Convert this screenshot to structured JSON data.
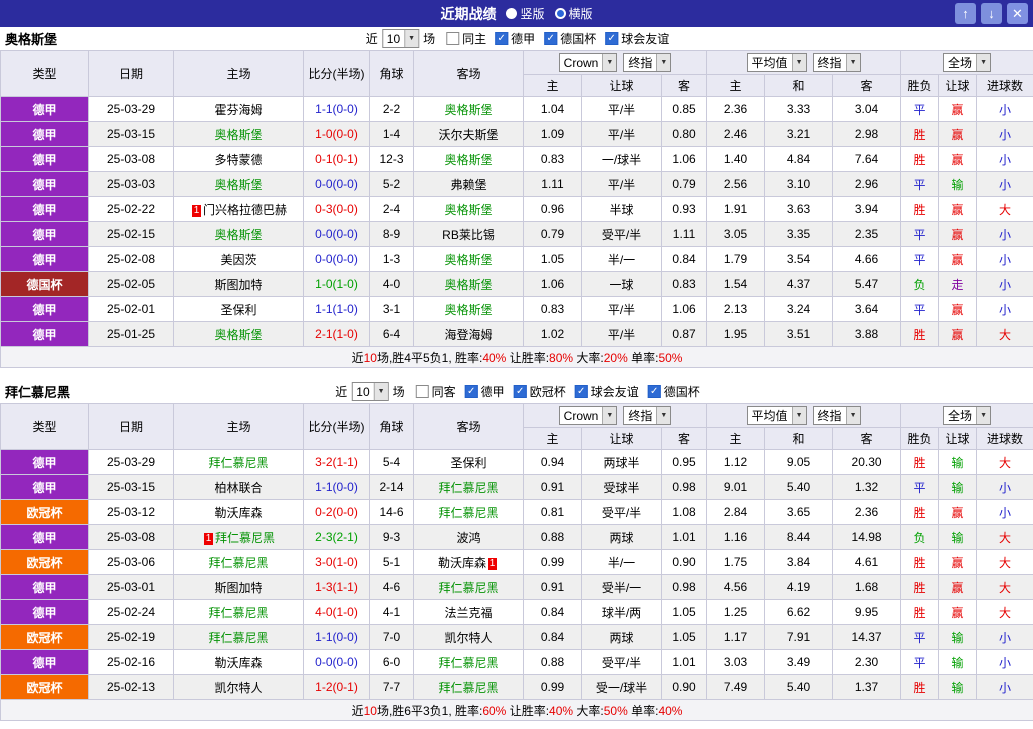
{
  "colors": {
    "titlebar_bg": "#2c2c9e",
    "header_bg": "#e9e9f3",
    "accent_blue": "#2e6bd4"
  },
  "titlebar": {
    "title": "近期战绩",
    "layout_options": [
      {
        "label": "竖版",
        "selected": false
      },
      {
        "label": "横版",
        "selected": true
      }
    ],
    "up_icon": "↑",
    "down_icon": "↓",
    "close_icon": "✕"
  },
  "table_columns": [
    "类型",
    "日期",
    "主场",
    "比分(半场)",
    "角球",
    "客场",
    "主",
    "让球",
    "客",
    "主",
    "和",
    "客",
    "胜负",
    "让球",
    "进球数"
  ],
  "league_colors": {
    "德甲": "#9327bd",
    "德国杯": "#a32626",
    "欧冠杯": "#f56a00"
  },
  "result_colors": {
    "胜": "#e60000",
    "平": "#2222cc",
    "负": "#00a000",
    "赢": "#e60000",
    "输": "#00a000",
    "走": "#8000a0",
    "大": "#e60000",
    "小": "#2222cc"
  },
  "sections": [
    {
      "team": "奥格斯堡",
      "filter": {
        "near_label": "近",
        "count": "10",
        "games_label": "场",
        "checkboxes": [
          {
            "label": "同主",
            "checked": false
          },
          {
            "label": "德甲",
            "checked": true
          },
          {
            "label": "德国杯",
            "checked": true
          },
          {
            "label": "球会友谊",
            "checked": true
          }
        ]
      },
      "header_selects": {
        "asia": [
          "Crown",
          "终指"
        ],
        "europe": [
          "平均值",
          "终指"
        ],
        "scope": [
          "全场"
        ]
      },
      "rows": [
        {
          "lg": "德甲",
          "dt": "25-03-29",
          "hm": "霍芬海姆",
          "hmF": false,
          "hmC": false,
          "sc": "1-1(0-0)",
          "cn": "2-2",
          "aw": "奥格斯堡",
          "awF": true,
          "awC": false,
          "asia": [
            "1.04",
            "平/半",
            "0.85"
          ],
          "euro": [
            "2.36",
            "3.33",
            "3.04"
          ],
          "res": "平",
          "hres": "赢",
          "gres": "小"
        },
        {
          "lg": "德甲",
          "dt": "25-03-15",
          "hm": "奥格斯堡",
          "hmF": true,
          "hmC": false,
          "sc": "1-0(0-0)",
          "cn": "1-4",
          "aw": "沃尔夫斯堡",
          "awF": false,
          "awC": false,
          "asia": [
            "1.09",
            "平/半",
            "0.80"
          ],
          "euro": [
            "2.46",
            "3.21",
            "2.98"
          ],
          "res": "胜",
          "hres": "赢",
          "gres": "小"
        },
        {
          "lg": "德甲",
          "dt": "25-03-08",
          "hm": "多特蒙德",
          "hmF": false,
          "hmC": false,
          "sc": "0-1(0-1)",
          "cn": "12-3",
          "aw": "奥格斯堡",
          "awF": true,
          "awC": false,
          "asia": [
            "0.83",
            "一/球半",
            "1.06"
          ],
          "euro": [
            "1.40",
            "4.84",
            "7.64"
          ],
          "res": "胜",
          "hres": "赢",
          "gres": "小"
        },
        {
          "lg": "德甲",
          "dt": "25-03-03",
          "hm": "奥格斯堡",
          "hmF": true,
          "hmC": false,
          "sc": "0-0(0-0)",
          "cn": "5-2",
          "aw": "弗赖堡",
          "awF": false,
          "awC": false,
          "asia": [
            "1.11",
            "平/半",
            "0.79"
          ],
          "euro": [
            "2.56",
            "3.10",
            "2.96"
          ],
          "res": "平",
          "hres": "输",
          "gres": "小"
        },
        {
          "lg": "德甲",
          "dt": "25-02-22",
          "hm": "门兴格拉德巴赫",
          "hmF": false,
          "hmC": true,
          "sc": "0-3(0-0)",
          "cn": "2-4",
          "aw": "奥格斯堡",
          "awF": true,
          "awC": false,
          "asia": [
            "0.96",
            "半球",
            "0.93"
          ],
          "euro": [
            "1.91",
            "3.63",
            "3.94"
          ],
          "res": "胜",
          "hres": "赢",
          "gres": "大"
        },
        {
          "lg": "德甲",
          "dt": "25-02-15",
          "hm": "奥格斯堡",
          "hmF": true,
          "hmC": false,
          "sc": "0-0(0-0)",
          "cn": "8-9",
          "aw": "RB莱比锡",
          "awF": false,
          "awC": false,
          "asia": [
            "0.79",
            "受平/半",
            "1.11"
          ],
          "euro": [
            "3.05",
            "3.35",
            "2.35"
          ],
          "res": "平",
          "hres": "赢",
          "gres": "小"
        },
        {
          "lg": "德甲",
          "dt": "25-02-08",
          "hm": "美因茨",
          "hmF": false,
          "hmC": false,
          "sc": "0-0(0-0)",
          "cn": "1-3",
          "aw": "奥格斯堡",
          "awF": true,
          "awC": false,
          "asia": [
            "1.05",
            "半/一",
            "0.84"
          ],
          "euro": [
            "1.79",
            "3.54",
            "4.66"
          ],
          "res": "平",
          "hres": "赢",
          "gres": "小"
        },
        {
          "lg": "德国杯",
          "dt": "25-02-05",
          "hm": "斯图加特",
          "hmF": false,
          "hmC": false,
          "sc": "1-0(1-0)",
          "cn": "4-0",
          "aw": "奥格斯堡",
          "awF": true,
          "awC": false,
          "asia": [
            "1.06",
            "一球",
            "0.83"
          ],
          "euro": [
            "1.54",
            "4.37",
            "5.47"
          ],
          "res": "负",
          "hres": "走",
          "gres": "小"
        },
        {
          "lg": "德甲",
          "dt": "25-02-01",
          "hm": "圣保利",
          "hmF": false,
          "hmC": false,
          "sc": "1-1(1-0)",
          "cn": "3-1",
          "aw": "奥格斯堡",
          "awF": true,
          "awC": false,
          "asia": [
            "0.83",
            "平/半",
            "1.06"
          ],
          "euro": [
            "2.13",
            "3.24",
            "3.64"
          ],
          "res": "平",
          "hres": "赢",
          "gres": "小"
        },
        {
          "lg": "德甲",
          "dt": "25-01-25",
          "hm": "奥格斯堡",
          "hmF": true,
          "hmC": false,
          "sc": "2-1(1-0)",
          "cn": "6-4",
          "aw": "海登海姆",
          "awF": false,
          "awC": false,
          "asia": [
            "1.02",
            "平/半",
            "0.87"
          ],
          "euro": [
            "1.95",
            "3.51",
            "3.88"
          ],
          "res": "胜",
          "hres": "赢",
          "gres": "大"
        }
      ],
      "summary": [
        {
          "text": "近",
          "red": false
        },
        {
          "text": "10",
          "red": true
        },
        {
          "text": "场,胜4平5负1, 胜率:",
          "red": false
        },
        {
          "text": "40%",
          "red": true
        },
        {
          "text": " 让胜率:",
          "red": false
        },
        {
          "text": "80%",
          "red": true
        },
        {
          "text": " 大率:",
          "red": false
        },
        {
          "text": "20%",
          "red": true
        },
        {
          "text": " 单率:",
          "red": false
        },
        {
          "text": "50%",
          "red": true
        }
      ]
    },
    {
      "team": "拜仁慕尼黑",
      "filter": {
        "near_label": "近",
        "count": "10",
        "games_label": "场",
        "checkboxes": [
          {
            "label": "同客",
            "checked": false
          },
          {
            "label": "德甲",
            "checked": true
          },
          {
            "label": "欧冠杯",
            "checked": true
          },
          {
            "label": "球会友谊",
            "checked": true
          },
          {
            "label": "德国杯",
            "checked": true
          }
        ]
      },
      "header_selects": {
        "asia": [
          "Crown",
          "终指"
        ],
        "europe": [
          "平均值",
          "终指"
        ],
        "scope": [
          "全场"
        ]
      },
      "rows": [
        {
          "lg": "德甲",
          "dt": "25-03-29",
          "hm": "拜仁慕尼黑",
          "hmF": true,
          "hmC": false,
          "sc": "3-2(1-1)",
          "cn": "5-4",
          "aw": "圣保利",
          "awF": false,
          "awC": false,
          "asia": [
            "0.94",
            "两球半",
            "0.95"
          ],
          "euro": [
            "1.12",
            "9.05",
            "20.30"
          ],
          "res": "胜",
          "hres": "输",
          "gres": "大"
        },
        {
          "lg": "德甲",
          "dt": "25-03-15",
          "hm": "柏林联合",
          "hmF": false,
          "hmC": false,
          "sc": "1-1(0-0)",
          "cn": "2-14",
          "aw": "拜仁慕尼黑",
          "awF": true,
          "awC": false,
          "asia": [
            "0.91",
            "受球半",
            "0.98"
          ],
          "euro": [
            "9.01",
            "5.40",
            "1.32"
          ],
          "res": "平",
          "hres": "输",
          "gres": "小"
        },
        {
          "lg": "欧冠杯",
          "dt": "25-03-12",
          "hm": "勒沃库森",
          "hmF": false,
          "hmC": false,
          "sc": "0-2(0-0)",
          "cn": "14-6",
          "aw": "拜仁慕尼黑",
          "awF": true,
          "awC": false,
          "asia": [
            "0.81",
            "受平/半",
            "1.08"
          ],
          "euro": [
            "2.84",
            "3.65",
            "2.36"
          ],
          "res": "胜",
          "hres": "赢",
          "gres": "小"
        },
        {
          "lg": "德甲",
          "dt": "25-03-08",
          "hm": "拜仁慕尼黑",
          "hmF": true,
          "hmC": true,
          "sc": "2-3(2-1)",
          "cn": "9-3",
          "aw": "波鸿",
          "awF": false,
          "awC": false,
          "asia": [
            "0.88",
            "两球",
            "1.01"
          ],
          "euro": [
            "1.16",
            "8.44",
            "14.98"
          ],
          "res": "负",
          "hres": "输",
          "gres": "大"
        },
        {
          "lg": "欧冠杯",
          "dt": "25-03-06",
          "hm": "拜仁慕尼黑",
          "hmF": true,
          "hmC": false,
          "sc": "3-0(1-0)",
          "cn": "5-1",
          "aw": "勒沃库森",
          "awF": false,
          "awC": true,
          "asia": [
            "0.99",
            "半/一",
            "0.90"
          ],
          "euro": [
            "1.75",
            "3.84",
            "4.61"
          ],
          "res": "胜",
          "hres": "赢",
          "gres": "大"
        },
        {
          "lg": "德甲",
          "dt": "25-03-01",
          "hm": "斯图加特",
          "hmF": false,
          "hmC": false,
          "sc": "1-3(1-1)",
          "cn": "4-6",
          "aw": "拜仁慕尼黑",
          "awF": true,
          "awC": false,
          "asia": [
            "0.91",
            "受半/一",
            "0.98"
          ],
          "euro": [
            "4.56",
            "4.19",
            "1.68"
          ],
          "res": "胜",
          "hres": "赢",
          "gres": "大"
        },
        {
          "lg": "德甲",
          "dt": "25-02-24",
          "hm": "拜仁慕尼黑",
          "hmF": true,
          "hmC": false,
          "sc": "4-0(1-0)",
          "cn": "4-1",
          "aw": "法兰克福",
          "awF": false,
          "awC": false,
          "asia": [
            "0.84",
            "球半/两",
            "1.05"
          ],
          "euro": [
            "1.25",
            "6.62",
            "9.95"
          ],
          "res": "胜",
          "hres": "赢",
          "gres": "大"
        },
        {
          "lg": "欧冠杯",
          "dt": "25-02-19",
          "hm": "拜仁慕尼黑",
          "hmF": true,
          "hmC": false,
          "sc": "1-1(0-0)",
          "cn": "7-0",
          "aw": "凯尔特人",
          "awF": false,
          "awC": false,
          "asia": [
            "0.84",
            "两球",
            "1.05"
          ],
          "euro": [
            "1.17",
            "7.91",
            "14.37"
          ],
          "res": "平",
          "hres": "输",
          "gres": "小"
        },
        {
          "lg": "德甲",
          "dt": "25-02-16",
          "hm": "勒沃库森",
          "hmF": false,
          "hmC": false,
          "sc": "0-0(0-0)",
          "cn": "6-0",
          "aw": "拜仁慕尼黑",
          "awF": true,
          "awC": false,
          "asia": [
            "0.88",
            "受平/半",
            "1.01"
          ],
          "euro": [
            "3.03",
            "3.49",
            "2.30"
          ],
          "res": "平",
          "hres": "输",
          "gres": "小"
        },
        {
          "lg": "欧冠杯",
          "dt": "25-02-13",
          "hm": "凯尔特人",
          "hmF": false,
          "hmC": false,
          "sc": "1-2(0-1)",
          "cn": "7-7",
          "aw": "拜仁慕尼黑",
          "awF": true,
          "awC": false,
          "asia": [
            "0.99",
            "受一/球半",
            "0.90"
          ],
          "euro": [
            "7.49",
            "5.40",
            "1.37"
          ],
          "res": "胜",
          "hres": "输",
          "gres": "小"
        }
      ],
      "summary": [
        {
          "text": "近",
          "red": false
        },
        {
          "text": "10",
          "red": true
        },
        {
          "text": "场,胜6平3负1, 胜率:",
          "red": false
        },
        {
          "text": "60%",
          "red": true
        },
        {
          "text": " 让胜率:",
          "red": false
        },
        {
          "text": "40%",
          "red": true
        },
        {
          "text": " 大率:",
          "red": false
        },
        {
          "text": "50%",
          "red": true
        },
        {
          "text": " 单率:",
          "red": false
        },
        {
          "text": "40%",
          "red": true
        }
      ]
    }
  ]
}
